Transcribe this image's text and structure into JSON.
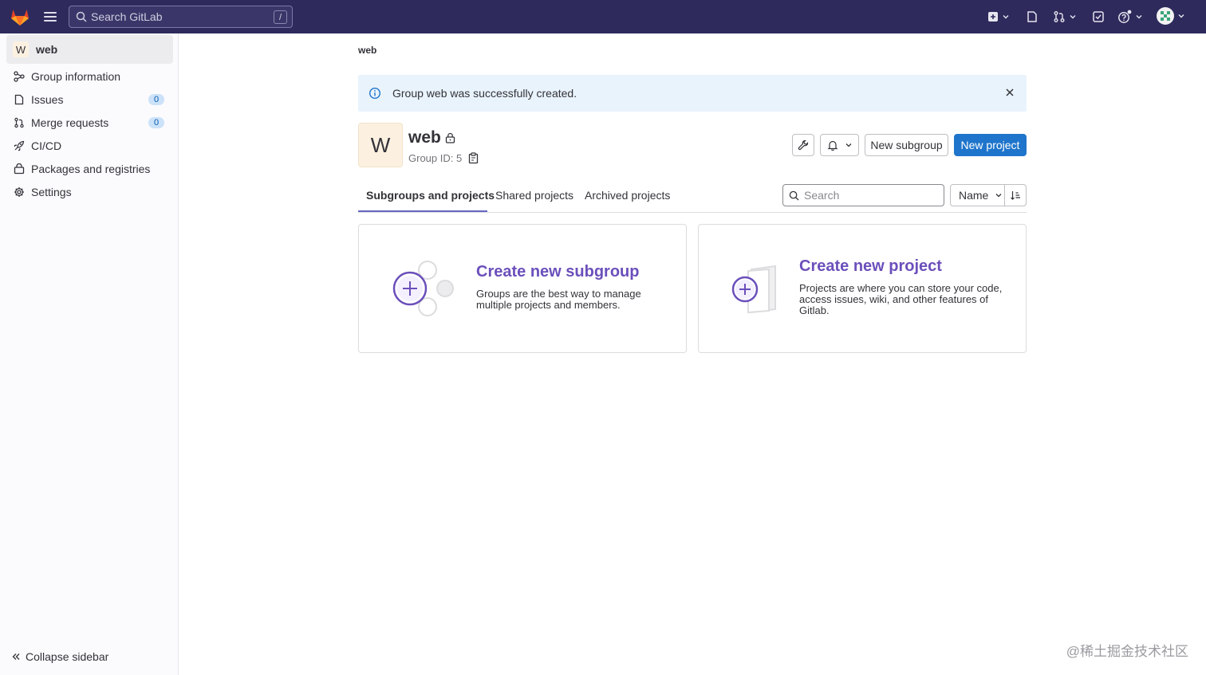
{
  "topbar": {
    "search_placeholder": "Search GitLab",
    "search_shortcut": "/",
    "icons": [
      "create-new-icon",
      "issues-icon",
      "merge-requests-icon",
      "todos-icon",
      "help-icon",
      "user-avatar"
    ]
  },
  "sidebar": {
    "group_initial": "W",
    "group_name": "web",
    "items": [
      {
        "label": "Group information",
        "icon": "group-info-icon"
      },
      {
        "label": "Issues",
        "icon": "issues-icon",
        "badge": "0"
      },
      {
        "label": "Merge requests",
        "icon": "merge-request-icon",
        "badge": "0"
      },
      {
        "label": "CI/CD",
        "icon": "rocket-icon"
      },
      {
        "label": "Packages and registries",
        "icon": "package-icon"
      },
      {
        "label": "Settings",
        "icon": "gear-icon"
      }
    ],
    "collapse_label": "Collapse sidebar"
  },
  "main": {
    "breadcrumb": "web",
    "alert": "Group web was successfully created.",
    "group": {
      "initial": "W",
      "name": "web",
      "id_label": "Group ID: 5"
    },
    "buttons": {
      "new_subgroup": "New subgroup",
      "new_project": "New project"
    },
    "tabs": [
      "Subgroups and projects",
      "Shared projects",
      "Archived projects"
    ],
    "search_placeholder": "Search",
    "sort_label": "Name",
    "cards": [
      {
        "title": "Create new subgroup",
        "description_lines": [
          "Groups are the best way to manage",
          "multiple projects and members."
        ]
      },
      {
        "title": "Create new project",
        "description_lines": [
          "Projects are where you can store your code,",
          "access issues, wiki, and other features of",
          "Gitlab."
        ]
      }
    ]
  },
  "watermark": "@稀土掘金技术社区",
  "colors": {
    "topbar": "#2e2a5c",
    "primary": "#1f75cb",
    "accent": "#6b4fbb",
    "alert_bg": "#e9f3fc"
  }
}
